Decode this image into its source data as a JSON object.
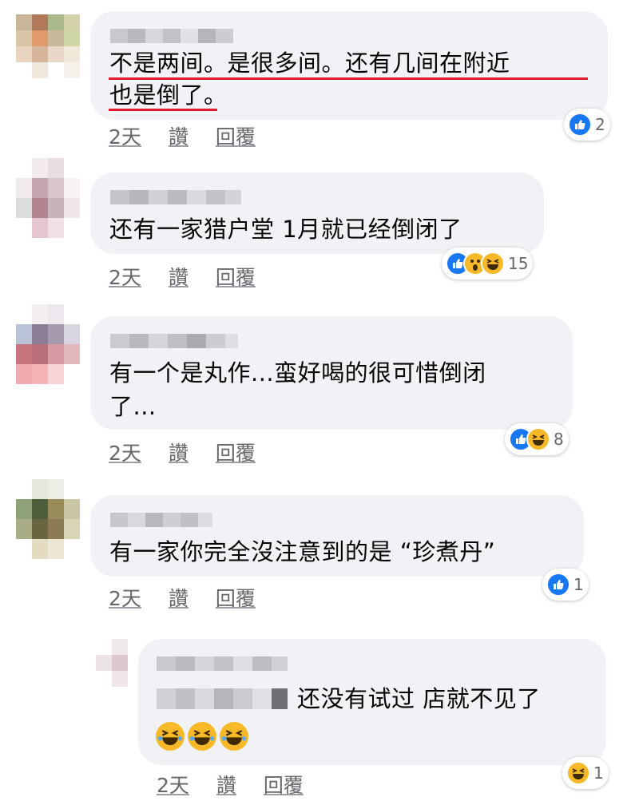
{
  "comments": [
    {
      "text_lines": [
        "不是两间。是很多间。还有几间在附近",
        "也是倒了。"
      ],
      "actions": {
        "time": "2天",
        "like": "讚",
        "reply": "回覆"
      },
      "reaction_count": "2"
    },
    {
      "text_lines": [
        "还有一家猎户堂 1月就已经倒闭了"
      ],
      "actions": {
        "time": "2天",
        "like": "讚",
        "reply": "回覆"
      },
      "reaction_count": "15"
    },
    {
      "text_lines": [
        "有一个是丸作...蛮好喝的很可惜倒闭",
        "了..."
      ],
      "actions": {
        "time": "2天",
        "like": "讚",
        "reply": "回覆"
      },
      "reaction_count": "8"
    },
    {
      "text_lines": [
        "有一家你完全沒注意到的是 “珍煮丹”"
      ],
      "actions": {
        "time": "2天",
        "like": "讚",
        "reply": "回覆"
      },
      "reaction_count": "1"
    },
    {
      "text_lines": [
        "还没有试过 店就不见了"
      ],
      "actions": {
        "time": "2天",
        "like": "讚",
        "reply": "回覆"
      },
      "reaction_count": "1"
    }
  ],
  "reaction_icons": [
    "like-icon",
    "wow-icon",
    "haha-icon"
  ],
  "colors": {
    "bubble": "#f0f2f5",
    "underline": "#e0182b",
    "like": "#1877f2",
    "emoji": "#f7b928",
    "secondary_text": "#65676b"
  }
}
